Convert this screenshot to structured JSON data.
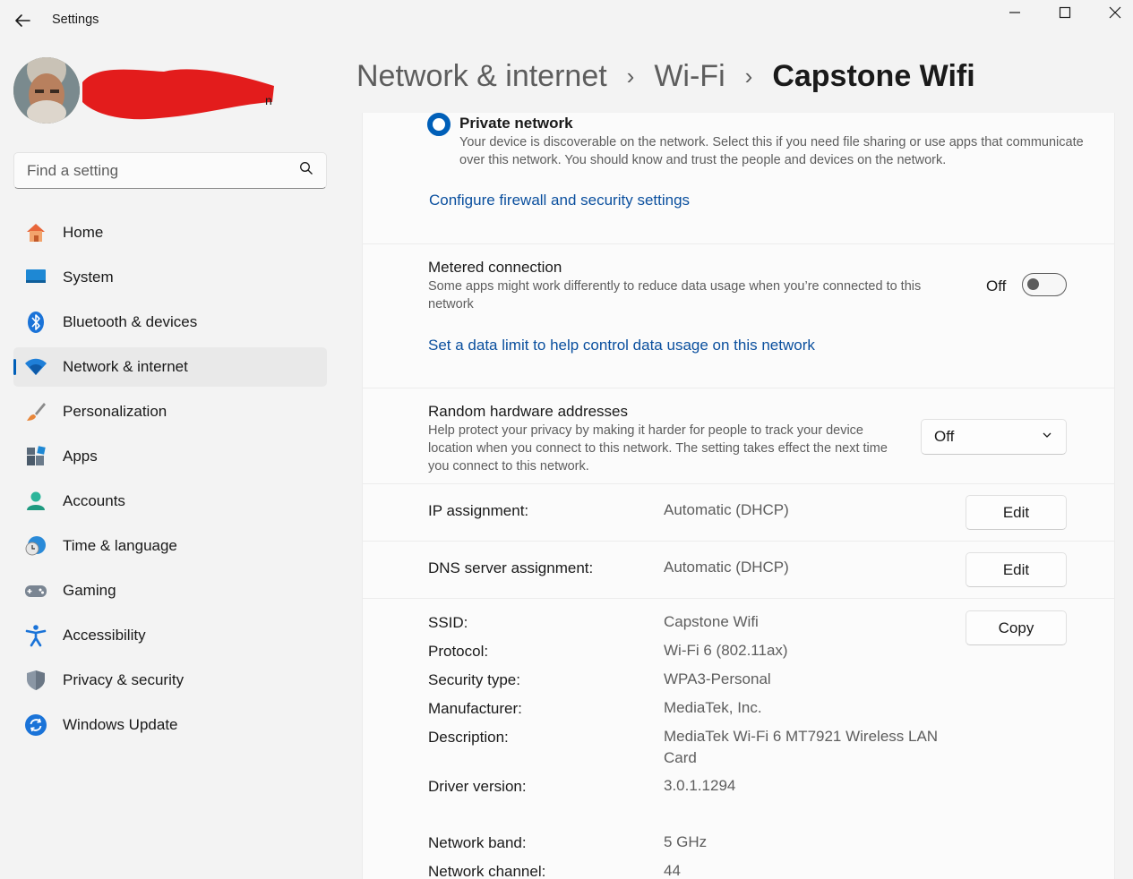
{
  "window": {
    "title": "Settings",
    "back_icon": "back-arrow-icon",
    "controls": [
      "minimize-icon",
      "maximize-icon",
      "close-icon"
    ]
  },
  "search": {
    "placeholder": "Find a setting",
    "icon": "search-icon"
  },
  "sidebar": {
    "items": [
      {
        "label": "Home",
        "icon": "home-icon",
        "active": false
      },
      {
        "label": "System",
        "icon": "system-icon",
        "active": false
      },
      {
        "label": "Bluetooth & devices",
        "icon": "bluetooth-icon",
        "active": false
      },
      {
        "label": "Network & internet",
        "icon": "wifi-icon",
        "active": true
      },
      {
        "label": "Personalization",
        "icon": "brush-icon",
        "active": false
      },
      {
        "label": "Apps",
        "icon": "apps-icon",
        "active": false
      },
      {
        "label": "Accounts",
        "icon": "account-icon",
        "active": false
      },
      {
        "label": "Time & language",
        "icon": "clock-globe-icon",
        "active": false
      },
      {
        "label": "Gaming",
        "icon": "gamepad-icon",
        "active": false
      },
      {
        "label": "Accessibility",
        "icon": "accessibility-icon",
        "active": false
      },
      {
        "label": "Privacy & security",
        "icon": "shield-icon",
        "active": false
      },
      {
        "label": "Windows Update",
        "icon": "update-icon",
        "active": false
      }
    ]
  },
  "breadcrumb": {
    "items": [
      "Network & internet",
      "Wi-Fi",
      "Capstone Wifi"
    ],
    "separator": "›"
  },
  "private_network": {
    "title": "Private network",
    "description": "Your device is discoverable on the network. Select this if you need file sharing or use apps that communicate over this network. You should know and trust the people and devices on the network.",
    "link": "Configure firewall and security settings"
  },
  "metered": {
    "title": "Metered connection",
    "description": "Some apps might work differently to reduce data usage when you’re connected to this network",
    "state_label": "Off",
    "link": "Set a data limit to help control data usage on this network"
  },
  "random_hw": {
    "title": "Random hardware addresses",
    "description": "Help protect your privacy by making it harder for people to track your device location when you connect to this network. The setting takes effect the next time you connect to this network.",
    "selected": "Off"
  },
  "ip": {
    "label": "IP assignment:",
    "value": "Automatic (DHCP)",
    "button": "Edit"
  },
  "dns": {
    "label": "DNS server assignment:",
    "value": "Automatic (DHCP)",
    "button": "Edit"
  },
  "properties": {
    "copy_button": "Copy",
    "rows": [
      {
        "label": "SSID:",
        "value": "Capstone Wifi"
      },
      {
        "label": "Protocol:",
        "value": "Wi-Fi 6 (802.11ax)"
      },
      {
        "label": "Security type:",
        "value": "WPA3-Personal"
      },
      {
        "label": "Manufacturer:",
        "value": "MediaTek, Inc."
      },
      {
        "label": "Description:",
        "value": "MediaTek Wi-Fi 6 MT7921 Wireless LAN Card"
      },
      {
        "label": "Driver version:",
        "value": "3.0.1.1294"
      },
      {
        "label": "Network band:",
        "value": "5 GHz"
      },
      {
        "label": "Network channel:",
        "value": "44"
      }
    ]
  },
  "colors": {
    "accent": "#005fb8",
    "link": "#0a4f9e",
    "redaction": "#e31c1c"
  }
}
